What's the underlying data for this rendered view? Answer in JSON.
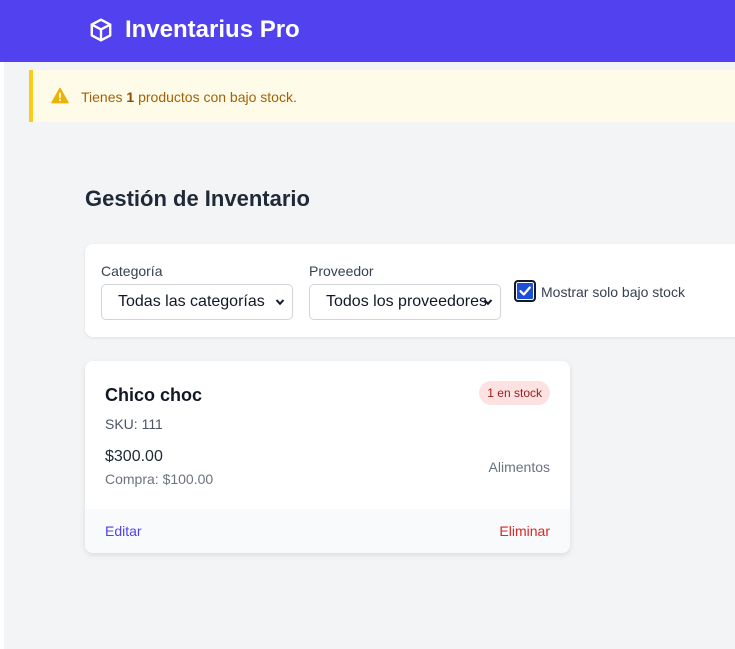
{
  "header": {
    "icon": "cube-icon",
    "title": "Inventarius Pro",
    "color": "#5141ef"
  },
  "alert": {
    "icon": "warning-icon",
    "prefix": "Tienes",
    "count": "1",
    "suffix": "productos con bajo stock."
  },
  "page": {
    "title": "Gestión de Inventario"
  },
  "filters": {
    "category_label": "Categoría",
    "category_value": "Todas las categorías",
    "supplier_label": "Proveedor",
    "supplier_value": "Todos los proveedores",
    "low_stock_checked": true,
    "low_stock_label": "Mostrar solo bajo stock"
  },
  "products": [
    {
      "name": "Chico choc",
      "stock_badge": "1 en stock",
      "sku": "SKU: 111",
      "price": "$300.00",
      "purchase_price": "Compra: $100.00",
      "category": "Alimentos",
      "edit_label": "Editar",
      "delete_label": "Eliminar"
    }
  ]
}
